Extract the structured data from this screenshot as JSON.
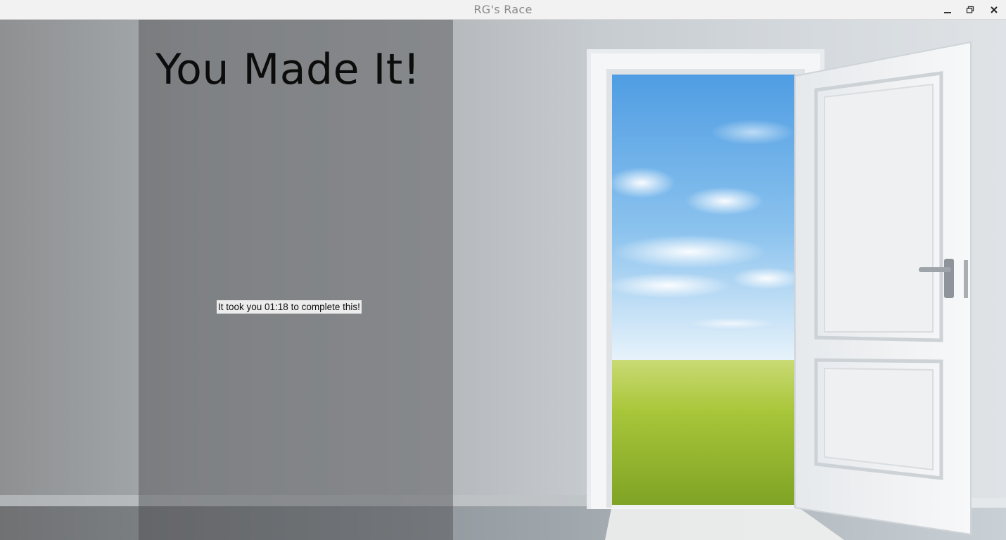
{
  "window": {
    "title": "RG's Race",
    "controls": {
      "minimize_icon": "minimize-icon",
      "maximize_icon": "restore-icon",
      "close_icon": "close-icon"
    }
  },
  "screen": {
    "headline": "You Made It!",
    "result_text": "It took you 01:18 to complete this!"
  },
  "background": {
    "scene": "open-door-to-meadow",
    "colors": {
      "wall": "#c7ccd0",
      "panel_overlay": "#464648",
      "sky": "#5aa6e6",
      "grass": "#a6c83a",
      "door": "#eef0f2"
    }
  }
}
